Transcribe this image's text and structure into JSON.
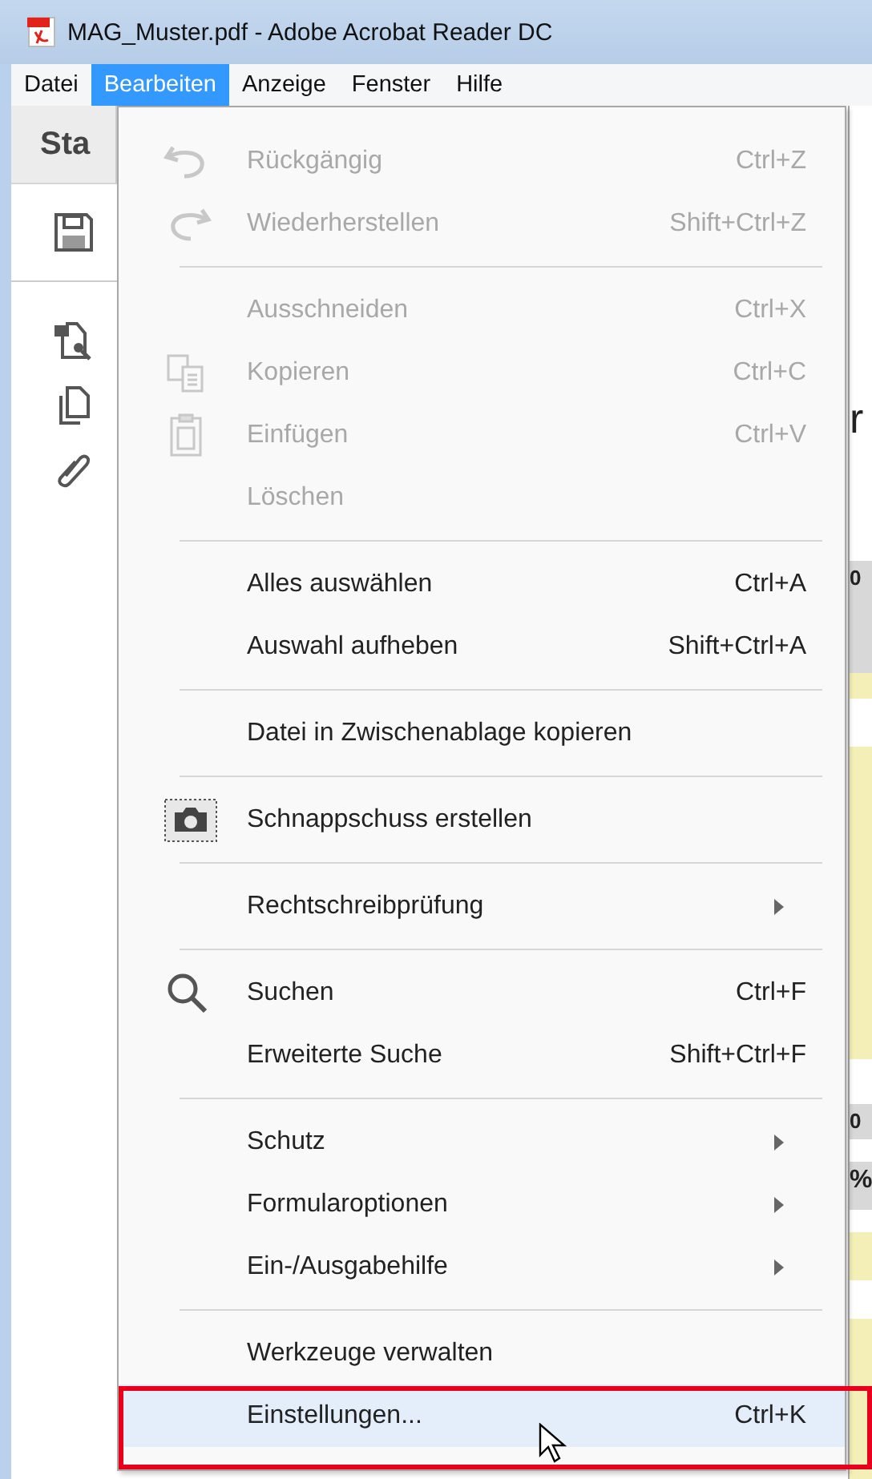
{
  "window": {
    "title": "MAG_Muster.pdf - Adobe Acrobat Reader DC"
  },
  "menubar": [
    {
      "label": "Datei",
      "selected": false
    },
    {
      "label": "Bearbeiten",
      "selected": true
    },
    {
      "label": "Anzeige",
      "selected": false
    },
    {
      "label": "Fenster",
      "selected": false
    },
    {
      "label": "Hilfe",
      "selected": false
    }
  ],
  "toolbar": {
    "tab_label": "Sta"
  },
  "document_edge": [
    {
      "text": "r"
    },
    {
      "text": "0"
    },
    {
      "text": "0"
    },
    {
      "text": "%"
    }
  ],
  "edit_menu": [
    {
      "kind": "item",
      "label": "Rückgängig",
      "shortcut": "Ctrl+Z",
      "disabled": true,
      "selected": false
    },
    {
      "kind": "item",
      "label": "Wiederherstellen",
      "shortcut": "Shift+Ctrl+Z",
      "disabled": true,
      "selected": false
    },
    {
      "kind": "separator"
    },
    {
      "kind": "item",
      "label": "Ausschneiden",
      "shortcut": "Ctrl+X",
      "disabled": true,
      "selected": false
    },
    {
      "kind": "item",
      "label": "Kopieren",
      "shortcut": "Ctrl+C",
      "disabled": true,
      "selected": false
    },
    {
      "kind": "item",
      "label": "Einfügen",
      "shortcut": "Ctrl+V",
      "disabled": true,
      "selected": false
    },
    {
      "kind": "item",
      "label": "Löschen",
      "disabled": true,
      "selected": false
    },
    {
      "kind": "separator"
    },
    {
      "kind": "item",
      "label": "Alles auswählen",
      "shortcut": "Ctrl+A",
      "disabled": false,
      "selected": false
    },
    {
      "kind": "item",
      "label": "Auswahl aufheben",
      "shortcut": "Shift+Ctrl+A",
      "disabled": false,
      "selected": false
    },
    {
      "kind": "separator"
    },
    {
      "kind": "item",
      "label": "Datei in Zwischenablage kopieren",
      "disabled": false,
      "selected": false
    },
    {
      "kind": "separator"
    },
    {
      "kind": "item",
      "label": "Schnappschuss erstellen",
      "disabled": false,
      "selected": false
    },
    {
      "kind": "separator"
    },
    {
      "kind": "item",
      "label": "Rechtschreibprüfung",
      "submenu": true,
      "disabled": false,
      "selected": false
    },
    {
      "kind": "separator"
    },
    {
      "kind": "item",
      "label": "Suchen",
      "shortcut": "Ctrl+F",
      "disabled": false,
      "selected": false
    },
    {
      "kind": "item",
      "label": "Erweiterte Suche",
      "shortcut": "Shift+Ctrl+F",
      "disabled": false,
      "selected": false
    },
    {
      "kind": "separator"
    },
    {
      "kind": "item",
      "label": "Schutz",
      "submenu": true,
      "disabled": false,
      "selected": false
    },
    {
      "kind": "item",
      "label": "Formularoptionen",
      "submenu": true,
      "disabled": false,
      "selected": false
    },
    {
      "kind": "item",
      "label": "Ein-/Ausgabehilfe",
      "submenu": true,
      "disabled": false,
      "selected": false
    },
    {
      "kind": "separator"
    },
    {
      "kind": "item",
      "label": "Werkzeuge verwalten",
      "disabled": false,
      "selected": false
    },
    {
      "kind": "item",
      "label": "Einstellungen...",
      "shortcut": "Ctrl+K",
      "disabled": false,
      "selected": true
    }
  ]
}
